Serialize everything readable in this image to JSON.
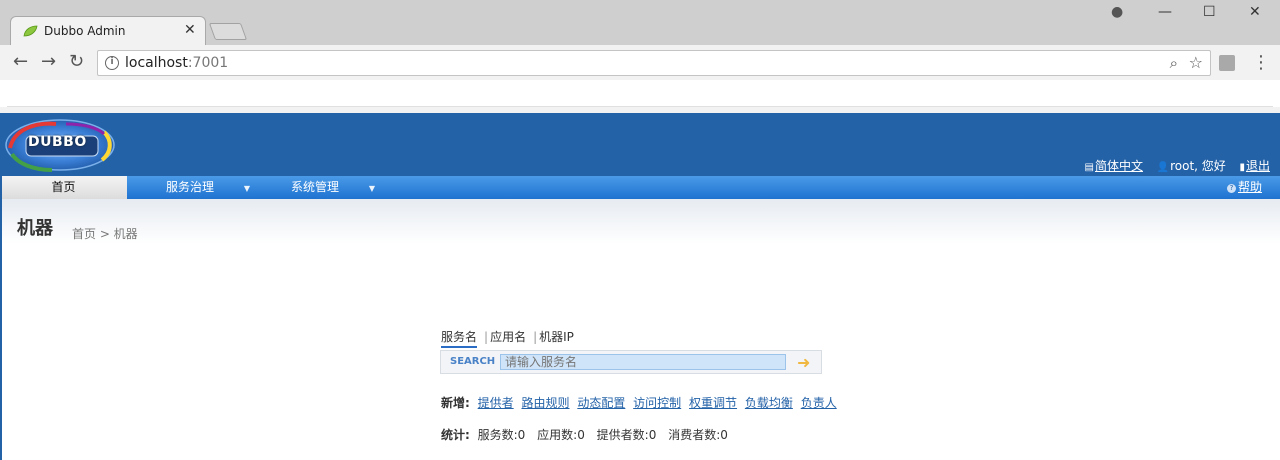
{
  "browser": {
    "tab_title": "Dubbo Admin",
    "tab_close": "✕",
    "url_host": "localhost",
    "url_port": ":7001",
    "back": "←",
    "forward": "→",
    "reload": "↻",
    "zoom": "⌕",
    "star": "☆",
    "menu": "⋮",
    "win_account": "●",
    "win_min": "—",
    "win_max": "☐",
    "win_close": "✕"
  },
  "header": {
    "logo_text": "DUBBO",
    "language": "简体中文",
    "user": "root, 您好",
    "logout": "退出"
  },
  "nav": {
    "items": [
      {
        "label": "首页"
      },
      {
        "label": "服务治理"
      },
      {
        "label": "系统管理"
      }
    ],
    "caret": "▼",
    "help": "帮助"
  },
  "page": {
    "title": "机器",
    "breadcrumb": "首页 > 机器"
  },
  "search": {
    "tabs": [
      "服务名",
      "应用名",
      "机器IP"
    ],
    "label": "SEARCH",
    "placeholder": "请输入服务名",
    "go": "➜"
  },
  "add": {
    "label": "新增:",
    "links": [
      "提供者",
      "路由规则",
      "动态配置",
      "访问控制",
      "权重调节",
      "负载均衡",
      "负责人"
    ]
  },
  "stats": {
    "label": "统计:",
    "items": [
      "服务数:0",
      "应用数:0",
      "提供者数:0",
      "消费者数:0"
    ]
  },
  "colors": {
    "header_bg": "#2462a8",
    "nav_bg": "#1f73d0",
    "link": "#2462a8"
  }
}
